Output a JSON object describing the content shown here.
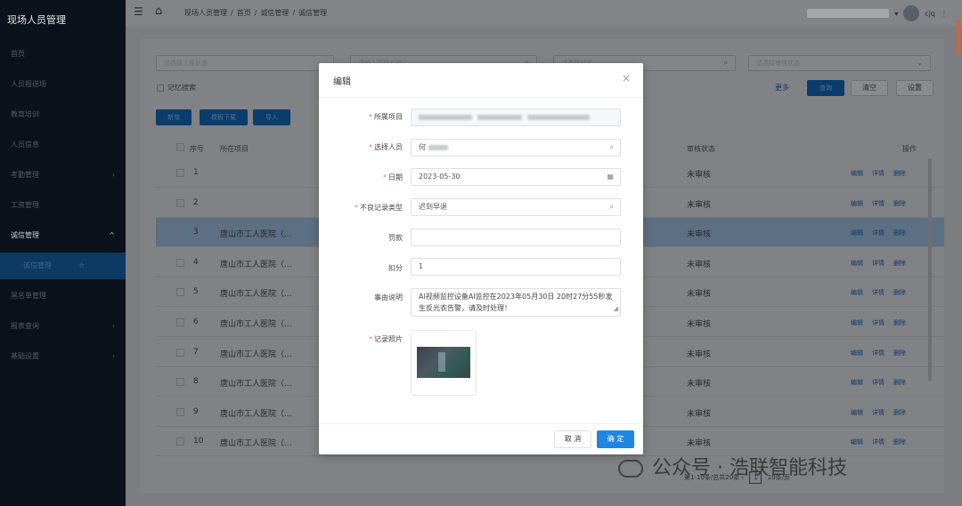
{
  "sidebar": {
    "title": "现场人员管理",
    "items": [
      {
        "label": "首页",
        "chevron": ""
      },
      {
        "label": "人员报送场",
        "chevron": ""
      },
      {
        "label": "教育培训",
        "chevron": ""
      },
      {
        "label": "人员信息",
        "chevron": ""
      },
      {
        "label": "考勤管理",
        "chevron": "›"
      },
      {
        "label": "工资管理",
        "chevron": ""
      },
      {
        "label": "诚信管理",
        "chevron": "^"
      },
      {
        "label": "诚信管理",
        "chevron": "☆"
      },
      {
        "label": "黑名单管理",
        "chevron": ""
      },
      {
        "label": "报表查询",
        "chevron": "›"
      },
      {
        "label": "基础设置",
        "chevron": "›"
      }
    ]
  },
  "topbar": {
    "menu_icon": "☰",
    "home_icon": "⌂",
    "breadcrumb": [
      "现场人员管理",
      "/",
      "首页",
      "/",
      "诚信管理",
      "/",
      "诚信管理"
    ],
    "user": "cjq",
    "user_caret": "▾",
    "more_icon": "⋮"
  },
  "filters": {
    "status_placeholder": "请选择上报状态",
    "search2_placeholder": "请输入项目名称",
    "search3_placeholder": "请选择时间",
    "audit_placeholder": "请选择审核状态",
    "memory_search": "记忆搜索",
    "more": "更多",
    "query": "查询",
    "clear": "清空",
    "settings": "设置"
  },
  "actions": {
    "add": "新增",
    "template": "模板下载",
    "import": "导入"
  },
  "table": {
    "headers": {
      "index": "序号",
      "project": "所在项目",
      "audit": "审核状态",
      "ops": "操作"
    },
    "ops": [
      "编辑",
      "详情",
      "删除"
    ],
    "rows": [
      {
        "index": "1",
        "project": "",
        "status": "未审核"
      },
      {
        "index": "2",
        "project": "",
        "status": "未审核"
      },
      {
        "index": "3",
        "project": "唐山市工人医院（...",
        "status": "未审核"
      },
      {
        "index": "4",
        "project": "唐山市工人医院（...",
        "status": "未审核"
      },
      {
        "index": "5",
        "project": "唐山市工人医院（...",
        "status": "未审核"
      },
      {
        "index": "6",
        "project": "唐山市工人医院（...",
        "status": "未审核"
      },
      {
        "index": "7",
        "project": "唐山市工人医院（...",
        "status": "未审核"
      },
      {
        "index": "8",
        "project": "唐山市工人医院（...",
        "status": "未审核"
      },
      {
        "index": "9",
        "project": "唐山市工人医院（...",
        "status": "未审核"
      },
      {
        "index": "10",
        "project": "唐山市工人医院（...",
        "status": "未审核"
      }
    ]
  },
  "pager": {
    "summary": "第1-10条/总共20条",
    "current": "1",
    "size": "10条/页"
  },
  "watermark": "公众号 · 浩联智能科技",
  "modal": {
    "title": "编辑",
    "close": "×",
    "fields": {
      "project_label": "所属项目",
      "person_label": "选择人员",
      "person_value": "何",
      "date_label": "日期",
      "date_value": "2023-05-30",
      "type_label": "不良记录类型",
      "type_value": "迟到早退",
      "fine_label": "罚款",
      "fine_value": "",
      "score_label": "扣分",
      "score_value": "1",
      "desc_label": "事由说明",
      "desc_value": "AI视频监控设备AI监控在2023年05月30日 20时27分55秒发生反光衣告警，请及时处理！",
      "photo_label": "记录照片"
    },
    "cancel": "取 消",
    "confirm": "确 定"
  }
}
